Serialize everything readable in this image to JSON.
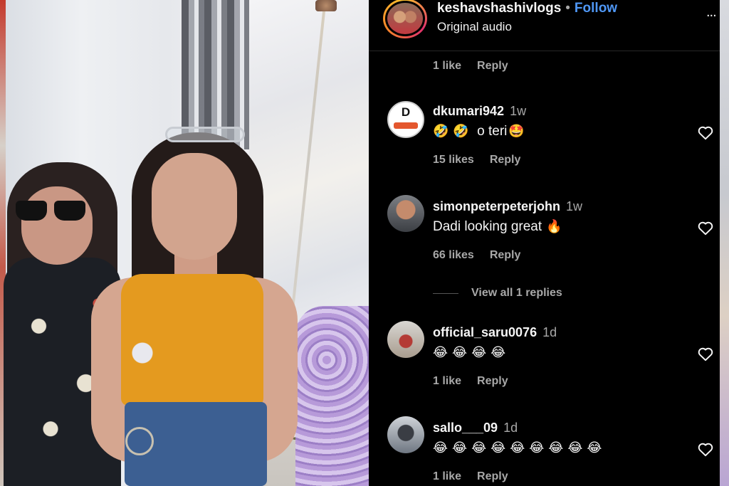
{
  "header": {
    "username": "keshavshashivlogs",
    "separator": "•",
    "follow_label": "Follow",
    "audio_label": "Original audio",
    "more_label": "..."
  },
  "top_meta": {
    "likes": "1 like",
    "reply": "Reply"
  },
  "comments": [
    {
      "username": "dkumari942",
      "age": "1w",
      "avatar_letter": "D",
      "emojis": [
        "🤣",
        "🤣"
      ],
      "text": "o teri",
      "trailing_emoji": "🤩",
      "likes": "15 likes",
      "reply": "Reply"
    },
    {
      "username": "simonpeterpeterjohn",
      "age": "1w",
      "text": "Dadi looking great",
      "trailing_emoji": "🔥",
      "likes": "66 likes",
      "reply": "Reply",
      "view_replies": "View all 1 replies"
    },
    {
      "username": "official_saru0076",
      "age": "1d",
      "emojis": [
        "😂",
        "😂",
        "😂",
        "😂"
      ],
      "likes": "1 like",
      "reply": "Reply"
    },
    {
      "username": "sallo___09",
      "age": "1d",
      "emojis": [
        "😂",
        "😂",
        "😂",
        "😂",
        "😂",
        "😂",
        "😂",
        "😂",
        "😂"
      ],
      "likes": "1 like",
      "reply": "Reply"
    }
  ],
  "colors": {
    "follow": "#4f97f5",
    "muted": "#a8a8a8",
    "panel_bg": "#000000"
  },
  "icons": {
    "like": "heart-icon",
    "more": "more-options-icon"
  }
}
